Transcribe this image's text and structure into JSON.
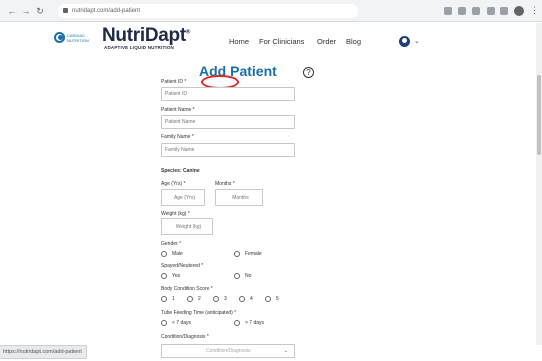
{
  "browser": {
    "url": "nutridapt.com/add-patient"
  },
  "header": {
    "logo_small_text": "CARDIAC NUTRITION",
    "brand_prefix": "Nutri",
    "brand_suffix": "Dapt",
    "brand_mark": "®",
    "brand_subtitle": "ADAPTIVE LIQUID NUTRITION",
    "nav": [
      "Home",
      "For Clinicians",
      "Order",
      "Blog"
    ]
  },
  "page": {
    "title": "Add Patient",
    "help_symbol": "?"
  },
  "form": {
    "patient_id": {
      "label": "Patient ID *",
      "placeholder": "Patient ID"
    },
    "patient_name": {
      "label": "Patient Name *",
      "placeholder": "Patient Name"
    },
    "family_name": {
      "label": "Family Name *",
      "placeholder": "Family Name"
    },
    "species_title": "Species: Canine",
    "age": {
      "label": "Age (Yrs) *",
      "placeholder": "Age (Yrs)"
    },
    "months": {
      "label": "Months *",
      "placeholder": "Months"
    },
    "weight": {
      "label": "Weight (kg) *",
      "placeholder": "Weight (kg)"
    },
    "gender": {
      "label": "Gender *",
      "options": [
        "Male",
        "Female"
      ]
    },
    "spayed": {
      "label": "Spayed/Neutered *",
      "options": [
        "Yes",
        "No"
      ]
    },
    "bcs": {
      "label": "Body Condition Score *",
      "options": [
        "1",
        "2",
        "3",
        "4",
        "5"
      ]
    },
    "tube_time": {
      "label": "Tube Feeding Time (anticipated) *",
      "options": [
        "< 7 days",
        "> 7 days"
      ]
    },
    "condition": {
      "label": "Condition/Diagnosis *",
      "placeholder": "Condition/Diagnosis"
    }
  },
  "status_bar": {
    "url": "https://nutridapt.com/add-patient"
  }
}
